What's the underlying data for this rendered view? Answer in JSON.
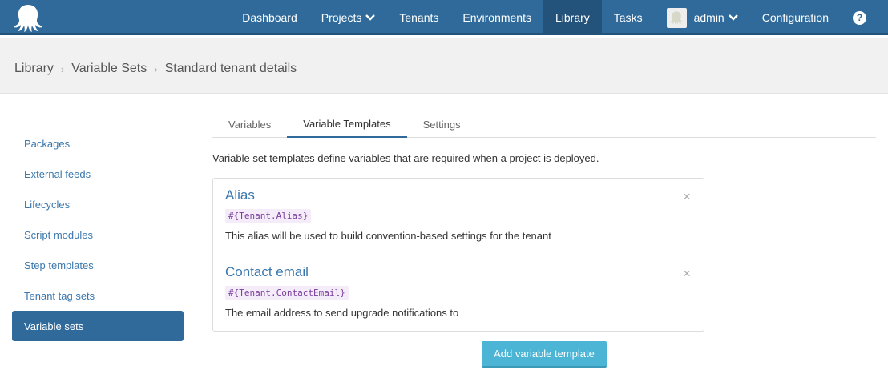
{
  "nav": {
    "items": [
      {
        "label": "Dashboard",
        "active": false
      },
      {
        "label": "Projects",
        "active": false,
        "dropdown": true
      },
      {
        "label": "Tenants",
        "active": false
      },
      {
        "label": "Environments",
        "active": false
      },
      {
        "label": "Library",
        "active": true
      },
      {
        "label": "Tasks",
        "active": false
      }
    ],
    "user": "admin",
    "configuration": "Configuration",
    "help_glyph": "?"
  },
  "breadcrumb": {
    "items": [
      "Library",
      "Variable Sets",
      "Standard tenant details"
    ],
    "separator": "›"
  },
  "sidebar": {
    "items": [
      {
        "label": "Packages"
      },
      {
        "label": "External feeds"
      },
      {
        "label": "Lifecycles"
      },
      {
        "label": "Script modules"
      },
      {
        "label": "Step templates"
      },
      {
        "label": "Tenant tag sets"
      },
      {
        "label": "Variable sets",
        "active": true
      }
    ]
  },
  "tabs": [
    {
      "label": "Variables"
    },
    {
      "label": "Variable Templates",
      "active": true
    },
    {
      "label": "Settings"
    }
  ],
  "description": "Variable set templates define variables that are required when a project is deployed.",
  "templates": [
    {
      "name": "Alias",
      "code": "#{Tenant.Alias}",
      "help": "This alias will be used to build convention-based settings for the tenant",
      "remove": "×"
    },
    {
      "name": "Contact email",
      "code": "#{Tenant.ContactEmail}",
      "help": "The email address to send upgrade notifications to",
      "remove": "×"
    }
  ],
  "add_button": "Add variable template",
  "colors": {
    "nav_bg": "#2f6a9a",
    "nav_active": "#23537a",
    "link": "#3a77ad",
    "button": "#4cb5d6",
    "code_text": "#7a3e9d"
  }
}
